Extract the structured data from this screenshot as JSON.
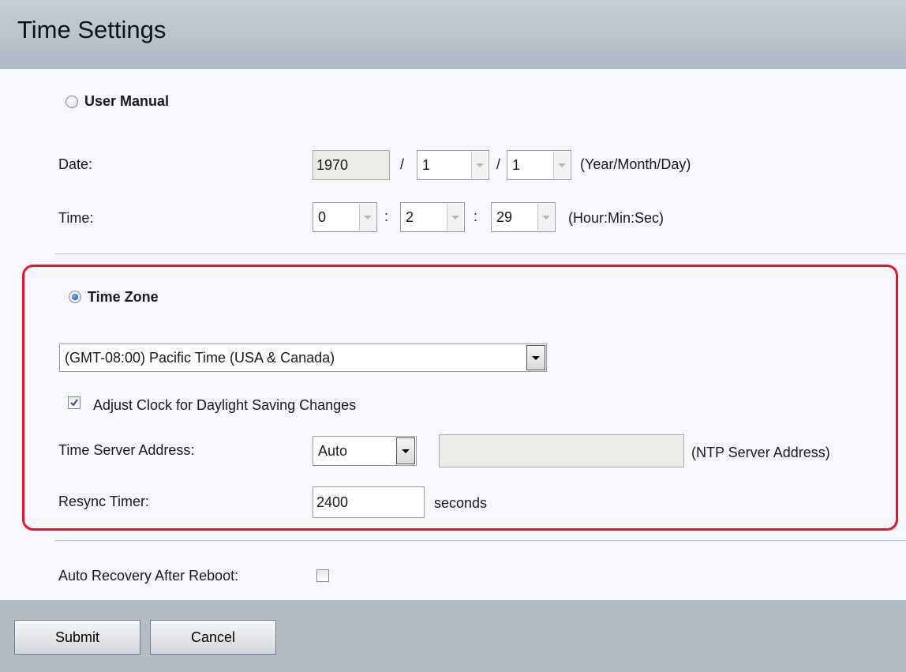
{
  "header": {
    "title": "Time Settings"
  },
  "manual": {
    "radio_label": "User Manual",
    "date_label": "Date:",
    "year": "1970",
    "month": "1",
    "day": "1",
    "date_sep": "/",
    "date_hint": "(Year/Month/Day)",
    "time_label": "Time:",
    "hour": "0",
    "minute": "2",
    "second": "29",
    "time_sep": ":",
    "time_hint": "(Hour:Min:Sec)"
  },
  "timezone": {
    "radio_label": "Time Zone",
    "selected_zone": "(GMT-08:00) Pacific Time (USA & Canada)",
    "dst_label": "Adjust Clock for Daylight Saving Changes",
    "dst_checked": true,
    "server_label": "Time Server Address:",
    "server_mode": "Auto",
    "server_hint": "(NTP Server Address)",
    "resync_label": "Resync Timer:",
    "resync_value": "2400",
    "resync_unit": "seconds"
  },
  "recovery": {
    "label": "Auto Recovery After Reboot:",
    "checked": false
  },
  "buttons": {
    "submit": "Submit",
    "cancel": "Cancel"
  },
  "colors": {
    "highlight": "#e8142a",
    "header_bg": "#b6c2cc",
    "panel_bg": "#f5f7fb"
  }
}
